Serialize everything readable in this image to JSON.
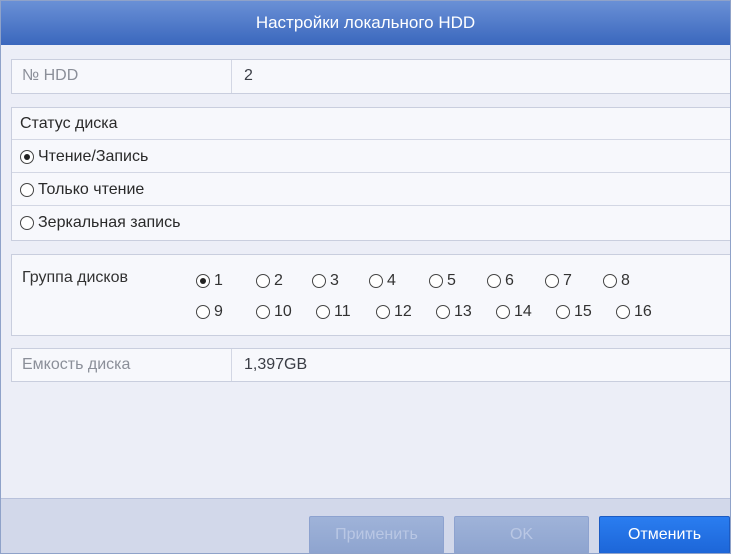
{
  "dialog": {
    "title": "Настройки локального HDD"
  },
  "hdd_no": {
    "label": "№ HDD",
    "value": "2"
  },
  "disk_status": {
    "heading": "Статус диска",
    "options": [
      {
        "label": "Чтение/Запись",
        "selected": true
      },
      {
        "label": "Только чтение",
        "selected": false
      },
      {
        "label": "Зеркальная запись",
        "selected": false
      }
    ]
  },
  "disk_group": {
    "label": "Группа дисков",
    "selected": "1",
    "options": [
      "1",
      "2",
      "3",
      "4",
      "5",
      "6",
      "7",
      "8",
      "9",
      "10",
      "11",
      "12",
      "13",
      "14",
      "15",
      "16"
    ]
  },
  "capacity": {
    "label": "Емкость диска",
    "value": "1,397GB"
  },
  "buttons": {
    "apply": "Применить",
    "ok": "OK",
    "cancel": "Отменить"
  }
}
